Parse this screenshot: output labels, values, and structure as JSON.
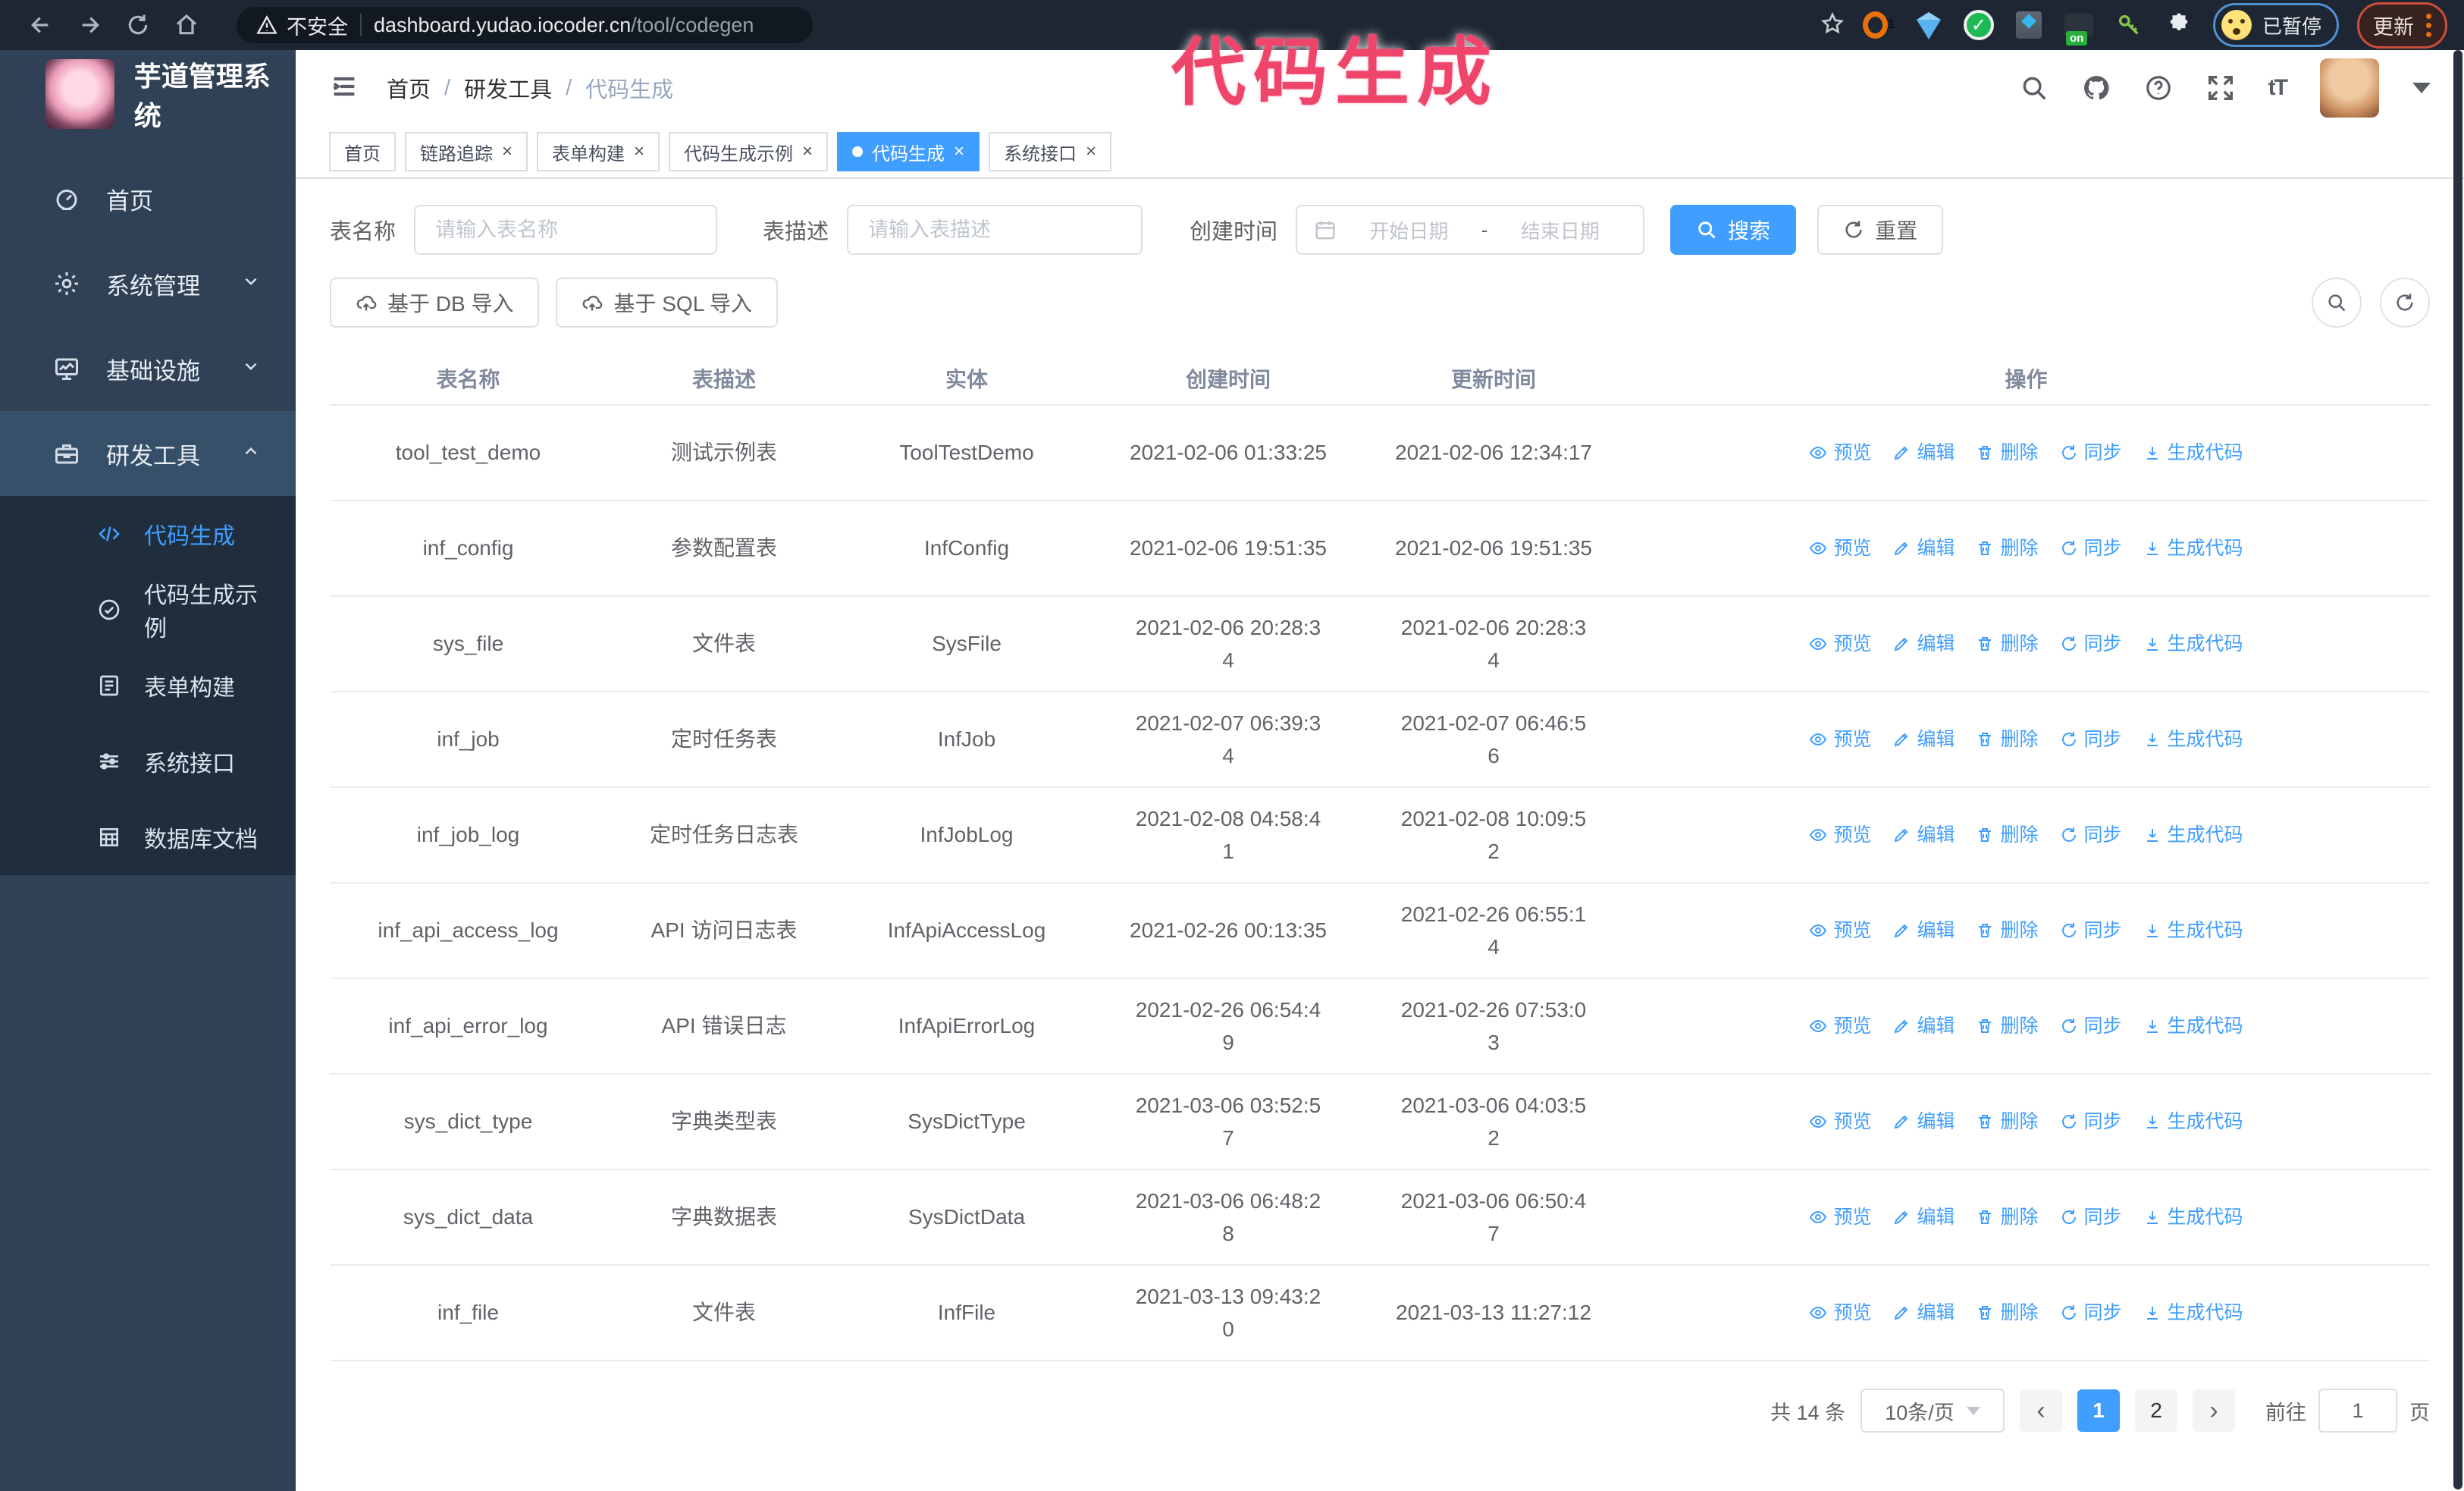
{
  "colors": {
    "accent": "#409eff",
    "annotation_pink": "#f0456b",
    "sidebar_bg": "#304156",
    "submenu_bg": "#1f2d3d"
  },
  "browser": {
    "security_label": "不安全",
    "url_host": "dashboard.yudao.iocoder.cn",
    "url_path": "/tool/codegen",
    "paused_label": "已暂停",
    "update_label": "更新"
  },
  "annotation": {
    "text": "代码生成"
  },
  "sidebar": {
    "app_title": "芋道管理系统",
    "menu": [
      {
        "label": "首页",
        "icon": "dashboard-icon",
        "type": "top"
      },
      {
        "label": "系统管理",
        "icon": "gear-icon",
        "type": "top",
        "chevron": "down"
      },
      {
        "label": "基础设施",
        "icon": "monitor-icon",
        "type": "top",
        "chevron": "down"
      },
      {
        "label": "研发工具",
        "icon": "toolbox-icon",
        "type": "top",
        "chevron": "up",
        "open": true
      },
      {
        "label": "代码生成",
        "icon": "code-icon",
        "type": "sub",
        "active": true
      },
      {
        "label": "代码生成示例",
        "icon": "example-icon",
        "type": "sub"
      },
      {
        "label": "表单构建",
        "icon": "form-icon",
        "type": "sub"
      },
      {
        "label": "系统接口",
        "icon": "api-icon",
        "type": "sub"
      },
      {
        "label": "数据库文档",
        "icon": "database-icon",
        "type": "sub"
      }
    ]
  },
  "breadcrumb": {
    "items": [
      "首页",
      "研发工具",
      "代码生成"
    ]
  },
  "tabs": [
    {
      "label": "首页",
      "closable": false,
      "active": false
    },
    {
      "label": "链路追踪",
      "closable": true,
      "active": false
    },
    {
      "label": "表单构建",
      "closable": true,
      "active": false
    },
    {
      "label": "代码生成示例",
      "closable": true,
      "active": false
    },
    {
      "label": "代码生成",
      "closable": true,
      "active": true
    },
    {
      "label": "系统接口",
      "closable": true,
      "active": false
    }
  ],
  "filter": {
    "name_label": "表名称",
    "name_placeholder": "请输入表名称",
    "desc_label": "表描述",
    "desc_placeholder": "请输入表描述",
    "time_label": "创建时间",
    "start_placeholder": "开始日期",
    "range_separator": "-",
    "end_placeholder": "结束日期",
    "search_label": "搜索",
    "reset_label": "重置"
  },
  "toolbar": {
    "import_db_label": "基于 DB 导入",
    "import_sql_label": "基于 SQL 导入"
  },
  "table": {
    "columns": [
      "表名称",
      "表描述",
      "实体",
      "创建时间",
      "更新时间",
      "操作"
    ],
    "ops": [
      "预览",
      "编辑",
      "删除",
      "同步",
      "生成代码"
    ],
    "rows": [
      {
        "name": "tool_test_demo",
        "desc": "测试示例表",
        "entity": "ToolTestDemo",
        "created": "2021-02-06 01:33:25",
        "updated": "2021-02-06 12:34:17"
      },
      {
        "name": "inf_config",
        "desc": "参数配置表",
        "entity": "InfConfig",
        "created": "2021-02-06 19:51:35",
        "updated": "2021-02-06 19:51:35"
      },
      {
        "name": "sys_file",
        "desc": "文件表",
        "entity": "SysFile",
        "created": "2021-02-06 20:28:3\n4",
        "updated": "2021-02-06 20:28:3\n4"
      },
      {
        "name": "inf_job",
        "desc": "定时任务表",
        "entity": "InfJob",
        "created": "2021-02-07 06:39:3\n4",
        "updated": "2021-02-07 06:46:5\n6"
      },
      {
        "name": "inf_job_log",
        "desc": "定时任务日志表",
        "entity": "InfJobLog",
        "created": "2021-02-08 04:58:4\n1",
        "updated": "2021-02-08 10:09:5\n2"
      },
      {
        "name": "inf_api_access_log",
        "desc": "API 访问日志表",
        "entity": "InfApiAccessLog",
        "created": "2021-02-26 00:13:35",
        "updated": "2021-02-26 06:55:1\n4"
      },
      {
        "name": "inf_api_error_log",
        "desc": "API 错误日志",
        "entity": "InfApiErrorLog",
        "created": "2021-02-26 06:54:4\n9",
        "updated": "2021-02-26 07:53:0\n3"
      },
      {
        "name": "sys_dict_type",
        "desc": "字典类型表",
        "entity": "SysDictType",
        "created": "2021-03-06 03:52:5\n7",
        "updated": "2021-03-06 04:03:5\n2"
      },
      {
        "name": "sys_dict_data",
        "desc": "字典数据表",
        "entity": "SysDictData",
        "created": "2021-03-06 06:48:2\n8",
        "updated": "2021-03-06 06:50:4\n7"
      },
      {
        "name": "inf_file",
        "desc": "文件表",
        "entity": "InfFile",
        "created": "2021-03-13 09:43:2\n0",
        "updated": "2021-03-13 11:27:12"
      }
    ]
  },
  "pagination": {
    "total_label": "共 14 条",
    "page_size": "10条/页",
    "prev": "‹",
    "next": "›",
    "pages": [
      "1",
      "2"
    ],
    "active_page": "1",
    "jump_prefix": "前往",
    "jump_value": "1",
    "jump_suffix": "页"
  }
}
